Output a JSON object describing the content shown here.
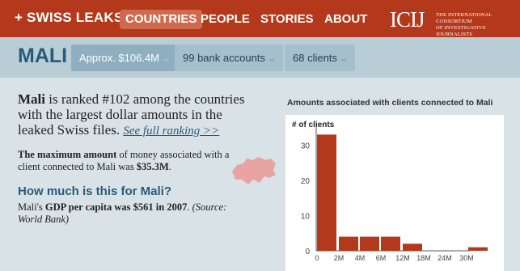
{
  "nav": {
    "brand": "+ SWISS LEAKS",
    "items": [
      {
        "label": "COUNTRIES",
        "active": true
      },
      {
        "label": "PEOPLE",
        "active": false
      },
      {
        "label": "STORIES",
        "active": false
      },
      {
        "label": "ABOUT",
        "active": false
      }
    ],
    "logo_mark": "ICIJ",
    "logo_text_line1": "THE INTERNATIONAL CONSORTIUM",
    "logo_text_line2": "OF INVESTIGATIVE JOURNALISTS"
  },
  "subbar": {
    "country": "MALI",
    "pills": [
      {
        "label": "Approx. $106.4M",
        "active": true
      },
      {
        "label": "99 bank accounts",
        "active": false
      },
      {
        "label": "68 clients",
        "active": false
      }
    ]
  },
  "summary": {
    "country_name": "Mali",
    "ranking_text": " is ranked #102 among the countries with the largest dollar amounts in the leaked Swiss files. ",
    "ranking_link": "See full ranking >>",
    "max_strong": "The maximum amount",
    "max_text": " of money associated with a client connected to Mali was ",
    "max_value": "$35.3M",
    "max_end": ".",
    "howmuch_heading": "How much is this for Mali?",
    "gdp_prefix": "Mali's ",
    "gdp_strong": "GDP per capita was $561 in 2007",
    "gdp_suffix": ". ",
    "gdp_source": "(Source: World Bank)"
  },
  "colors": {
    "nav_bg": "#b4391c",
    "bar": "#b4391c",
    "swiss": "#e8a3a3",
    "accent_blue": "#2a5a7a"
  },
  "chart_data": {
    "type": "bar",
    "title": "Amounts associated with clients connected to Mali",
    "ylabel": "# of clients",
    "xlabel": "",
    "x_tick_labels": [
      "0",
      "2M",
      "4M",
      "6M",
      "12M",
      "18M",
      "24M",
      "30M"
    ],
    "y_ticks": [
      0,
      10,
      20,
      30
    ],
    "ylim": [
      0,
      34
    ],
    "bins": [
      {
        "range": "0-1M",
        "value": 33
      },
      {
        "range": "1M-2M",
        "value": 4
      },
      {
        "range": "2M-4M",
        "value": 4
      },
      {
        "range": "4M-6M",
        "value": 4
      },
      {
        "range": "6M-12M",
        "value": 2
      },
      {
        "range": "12M-18M",
        "value": 0
      },
      {
        "range": "18M-24M",
        "value": 0
      },
      {
        "range": "24M-30M",
        "value": 0
      },
      {
        "range": "30M+",
        "value": 1
      }
    ]
  }
}
